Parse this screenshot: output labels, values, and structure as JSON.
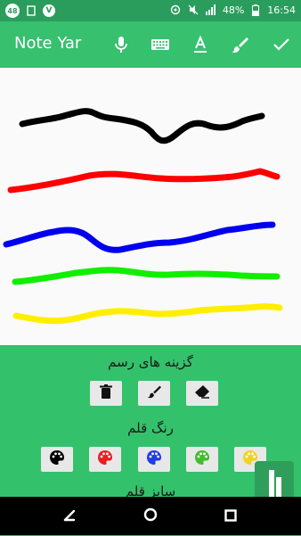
{
  "status_bar": {
    "notification_count": "48",
    "v_badge": "V",
    "battery_percent": "48%",
    "time": "16:54"
  },
  "toolbar": {
    "title": "Note Yar",
    "icons": [
      "mic-icon",
      "keyboard-icon",
      "text-format-icon",
      "brush-icon",
      "check-icon"
    ]
  },
  "canvas": {
    "strokes": [
      {
        "color": "#000000",
        "name": "black"
      },
      {
        "color": "#ff0000",
        "name": "red"
      },
      {
        "color": "#0000ee",
        "name": "blue"
      },
      {
        "color": "#11ee00",
        "name": "green"
      },
      {
        "color": "#ffee00",
        "name": "yellow"
      }
    ]
  },
  "tools_panel": {
    "drawing_options_title": "گزینه های رسم",
    "drawing_tools": [
      "trash-icon",
      "brush-icon",
      "eraser-icon"
    ],
    "pen_color_title": "رنگ قلم",
    "palette_colors": [
      "#000000",
      "#e81f1f",
      "#1f3ee8",
      "#3fbf2a",
      "#f2d21f"
    ],
    "pen_size_title": "سایز قلم"
  },
  "colors": {
    "primary": "#37c06e",
    "primary_dark": "#2a9d5c",
    "canvas_bg": "#fafafa"
  }
}
